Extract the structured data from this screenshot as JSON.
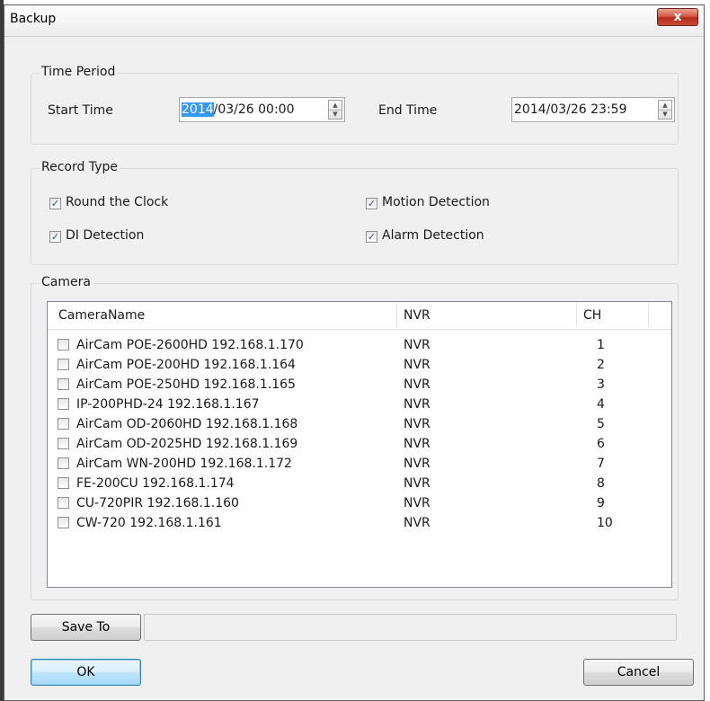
{
  "window": {
    "title": "Backup",
    "close_label": "x"
  },
  "time_period": {
    "label": "Time Period",
    "start_label": "Start Time",
    "start_value_selected": "2014",
    "start_value_rest": "/03/26 00:00",
    "end_label": "End Time",
    "end_value": "2014/03/26 23:59"
  },
  "record_type": {
    "label": "Record Type",
    "options": [
      {
        "label": "Round the Clock",
        "checked": true
      },
      {
        "label": "Motion Detection",
        "checked": true
      },
      {
        "label": "DI Detection",
        "checked": true
      },
      {
        "label": "Alarm Detection",
        "checked": true
      }
    ]
  },
  "camera": {
    "label": "Camera",
    "columns": [
      "CameraName",
      "NVR",
      "CH"
    ],
    "rows": [
      {
        "name": "AirCam POE-2600HD 192.168.1.170",
        "nvr": "NVR",
        "ch": "1",
        "checked": false
      },
      {
        "name": "AirCam POE-200HD 192.168.1.164",
        "nvr": "NVR",
        "ch": "2",
        "checked": false
      },
      {
        "name": "AirCam POE-250HD 192.168.1.165",
        "nvr": "NVR",
        "ch": "3",
        "checked": false
      },
      {
        "name": "IP-200PHD-24 192.168.1.167",
        "nvr": "NVR",
        "ch": "4",
        "checked": false
      },
      {
        "name": "AirCam OD-2060HD 192.168.1.168",
        "nvr": "NVR",
        "ch": "5",
        "checked": false
      },
      {
        "name": "AirCam OD-2025HD 192.168.1.169",
        "nvr": "NVR",
        "ch": "6",
        "checked": false
      },
      {
        "name": "AirCam WN-200HD 192.168.1.172",
        "nvr": "NVR",
        "ch": "7",
        "checked": false
      },
      {
        "name": "FE-200CU 192.168.1.174",
        "nvr": "NVR",
        "ch": "8",
        "checked": false
      },
      {
        "name": "CU-720PIR 192.168.1.160",
        "nvr": "NVR",
        "ch": "9",
        "checked": false
      },
      {
        "name": "CW-720 192.168.1.161",
        "nvr": "NVR",
        "ch": "10",
        "checked": false
      }
    ]
  },
  "save_to": {
    "label": "Save To",
    "path": ""
  },
  "buttons": {
    "ok": "OK",
    "cancel": "Cancel"
  },
  "colors": {
    "selection": "#3399ff",
    "close_button": "#c84a36",
    "check_mark": "#2a56a5"
  },
  "icons": {
    "checkbox_checked": "check-icon",
    "spin_up": "triangle-up-icon",
    "spin_down": "triangle-down-icon"
  }
}
